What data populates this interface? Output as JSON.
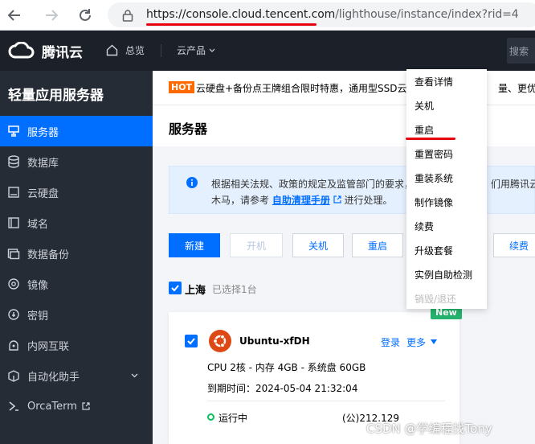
{
  "browser": {
    "url_host": "https://console.cloud.tencent.com",
    "url_path": "/lighthouse/instance/index?rid=4"
  },
  "topnav": {
    "brand": "腾讯云",
    "overview": "总览",
    "products": "云产品",
    "search_placeholder": "搜索"
  },
  "sidebar": {
    "title": "轻量应用服务器",
    "items": [
      {
        "label": "服务器",
        "icon": "server-icon"
      },
      {
        "label": "数据库",
        "icon": "database-icon"
      },
      {
        "label": "云硬盘",
        "icon": "disk-icon"
      },
      {
        "label": "域名",
        "icon": "domain-icon"
      },
      {
        "label": "数据备份",
        "icon": "backup-icon"
      },
      {
        "label": "镜像",
        "icon": "image-icon"
      },
      {
        "label": "密钥",
        "icon": "key-icon"
      },
      {
        "label": "内网互联",
        "icon": "network-icon"
      },
      {
        "label": "自动化助手",
        "icon": "automation-icon"
      },
      {
        "label": "OrcaTerm",
        "icon": "terminal-icon"
      }
    ]
  },
  "banner": {
    "tag": "HOT",
    "text": "云硬盘+备份点王牌组合限时特惠，通用型SSD云硬",
    "text_right": "量、更优惠"
  },
  "page": {
    "title": "服务器"
  },
  "notice": {
    "line1": "根据相关法规、政策的规定及监管部门的要求，",
    "line1_right": "们用腾讯云服",
    "line2_prefix": "木马，请参考",
    "line2_link": "自助清理手册",
    "line2_suffix": "进行处理。"
  },
  "toolbar": {
    "create": "新建",
    "start": "开机",
    "shutdown": "关机",
    "reboot": "重启",
    "renew": "续费"
  },
  "region": {
    "name": "上海",
    "selected": "已选择1台"
  },
  "instance": {
    "badge": "New",
    "name": "Ubuntu-xfDH",
    "login": "登录",
    "more": "更多",
    "spec": "CPU 2核 - 内存 4GB - 系统盘 60GB",
    "expire": "到期时间：2024-05-04 21:32:04",
    "status": "运行中",
    "ip": "(公)212.129"
  },
  "dropdown": {
    "items": [
      "查看详情",
      "关机",
      "重启",
      "重置密码",
      "重装系统",
      "制作镜像",
      "续费",
      "升级套餐",
      "实例自助检测",
      "销毁/退还"
    ]
  },
  "watermark": "CSDN @学编程找Tony",
  "colors": {
    "accent": "#006eff",
    "hot": "#ff6a00",
    "success": "#0abf5b",
    "highlight_underline": "#e8000f"
  }
}
